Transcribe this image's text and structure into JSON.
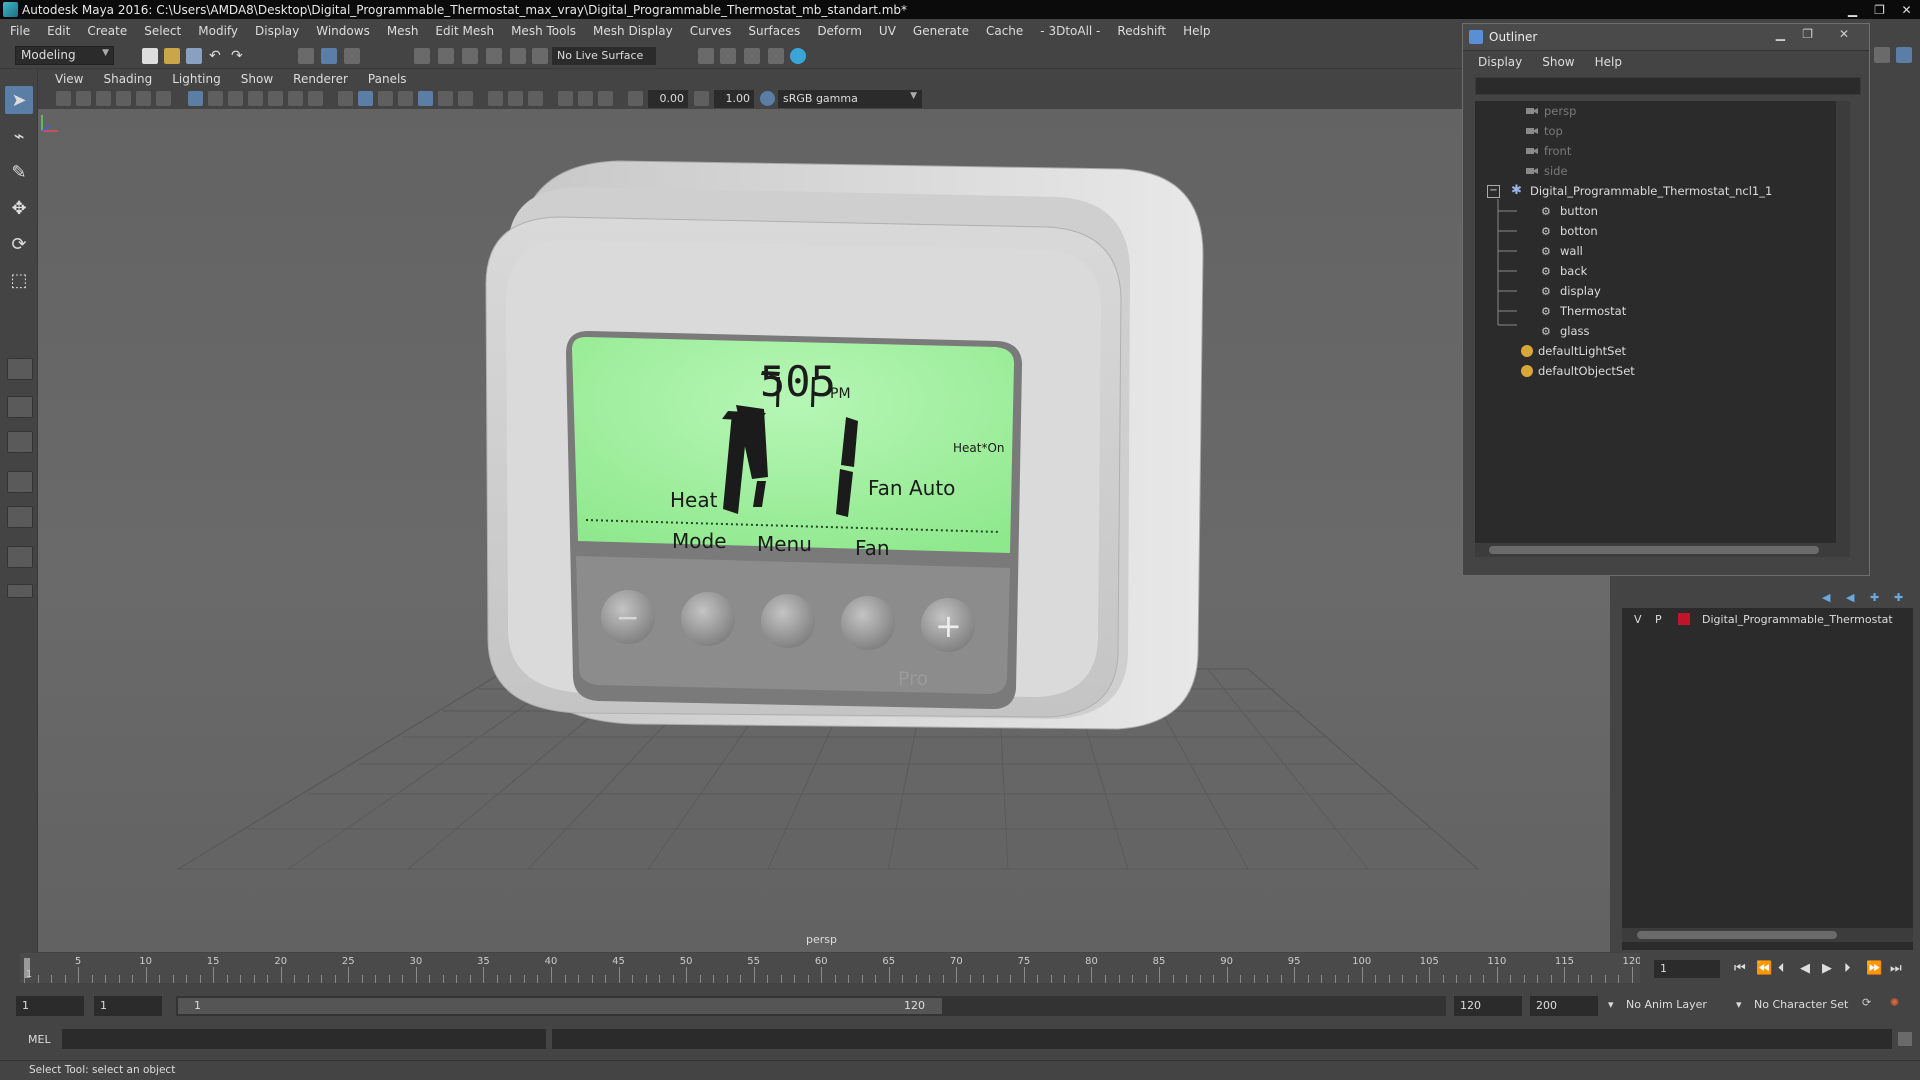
{
  "window": {
    "title": "Autodesk Maya 2016: C:\\Users\\AMDA8\\Desktop\\Digital_Programmable_Thermostat_max_vray\\Digital_Programmable_Thermostat_mb_standart.mb*"
  },
  "menubar": [
    "File",
    "Edit",
    "Create",
    "Select",
    "Modify",
    "Display",
    "Windows",
    "Mesh",
    "Edit Mesh",
    "Mesh Tools",
    "Mesh Display",
    "Curves",
    "Surfaces",
    "Deform",
    "UV",
    "Generate",
    "Cache",
    "- 3DtoAll -",
    "Redshift",
    "Help"
  ],
  "statusline": {
    "mode": "Modeling",
    "live_surface": "No Live Surface"
  },
  "viewport": {
    "menu": [
      "View",
      "Shading",
      "Lighting",
      "Show",
      "Renderer",
      "Panels"
    ],
    "exposure": "0.00",
    "gamma_value": "1.00",
    "color_space": "sRGB gamma",
    "camera_label": "persp"
  },
  "thermostat": {
    "time": "505",
    "ampm": "PM",
    "status": "Heat*On",
    "mode_label": "Heat",
    "fan_label": "Fan Auto",
    "buttons": [
      "Mode",
      "Menu",
      "Fan"
    ],
    "brand": "Pro",
    "minus": "−",
    "plus": "+"
  },
  "outliner": {
    "title": "Outliner",
    "menu": [
      "Display",
      "Show",
      "Help"
    ],
    "cameras": [
      "persp",
      "top",
      "front",
      "side"
    ],
    "group": "Digital_Programmable_Thermostat_ncl1_1",
    "children": [
      "button",
      "botton",
      "wall",
      "back",
      "display",
      "Thermostat",
      "glass"
    ],
    "sets": [
      "defaultLightSet",
      "defaultObjectSet"
    ]
  },
  "layer": {
    "v": "V",
    "p": "P",
    "name": "Digital_Programmable_Thermostat",
    "color": "#c0142a"
  },
  "timeslider": {
    "ticks": [
      5,
      10,
      15,
      20,
      25,
      30,
      35,
      40,
      45,
      50,
      55,
      60,
      65,
      70,
      75,
      80,
      85,
      90,
      95,
      100,
      105,
      110,
      115,
      120
    ],
    "current_marker": "1",
    "current_frame": "1"
  },
  "range": {
    "start": "1",
    "playback_start": "1",
    "slider_start": "1",
    "slider_end": "120",
    "playback_end": "120",
    "end": "200",
    "anim_layer": "No Anim Layer",
    "character_set": "No Character Set"
  },
  "cmdline": {
    "label": "MEL"
  },
  "helpline": {
    "text": "Select Tool: select an object"
  }
}
